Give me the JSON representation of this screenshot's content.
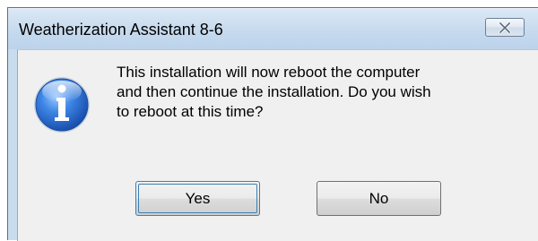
{
  "window": {
    "title": "Weatherization Assistant 8-6",
    "close_icon": "close-icon"
  },
  "message": {
    "icon": "information-icon",
    "text": "This installation will now reboot the computer\nand then continue the installation. Do you wish\nto reboot at this time?"
  },
  "buttons": {
    "yes_label": "Yes",
    "no_label": "No"
  },
  "colors": {
    "titlebar": "#c6daee",
    "client_background": "#f0f0f0",
    "info_icon_blue": "#2a6fd0"
  }
}
